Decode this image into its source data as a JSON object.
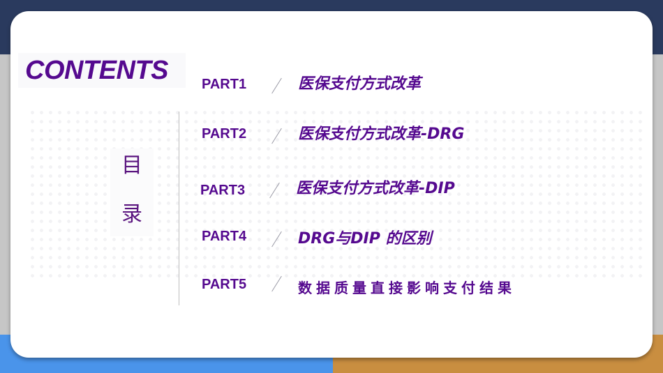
{
  "slide": {
    "heading": "CONTENTS",
    "subheading_chars": [
      "目",
      "录"
    ],
    "colors": {
      "accent": "#55098f",
      "top_band": "#2a3a5e",
      "bottom_left_band": "#4a94ea",
      "bottom_right_band": "#c98e40"
    },
    "items": [
      {
        "part": "PART1",
        "title": "医保支付方式改革"
      },
      {
        "part": "PART2",
        "title": "医保支付方式改革-DRG"
      },
      {
        "part": "PART3",
        "title": "医保支付方式改革-DIP"
      },
      {
        "part": "PART4",
        "title": "DRG与DIP 的区别"
      },
      {
        "part": "PART5",
        "title": "数据质量直接影响支付结果"
      }
    ]
  }
}
